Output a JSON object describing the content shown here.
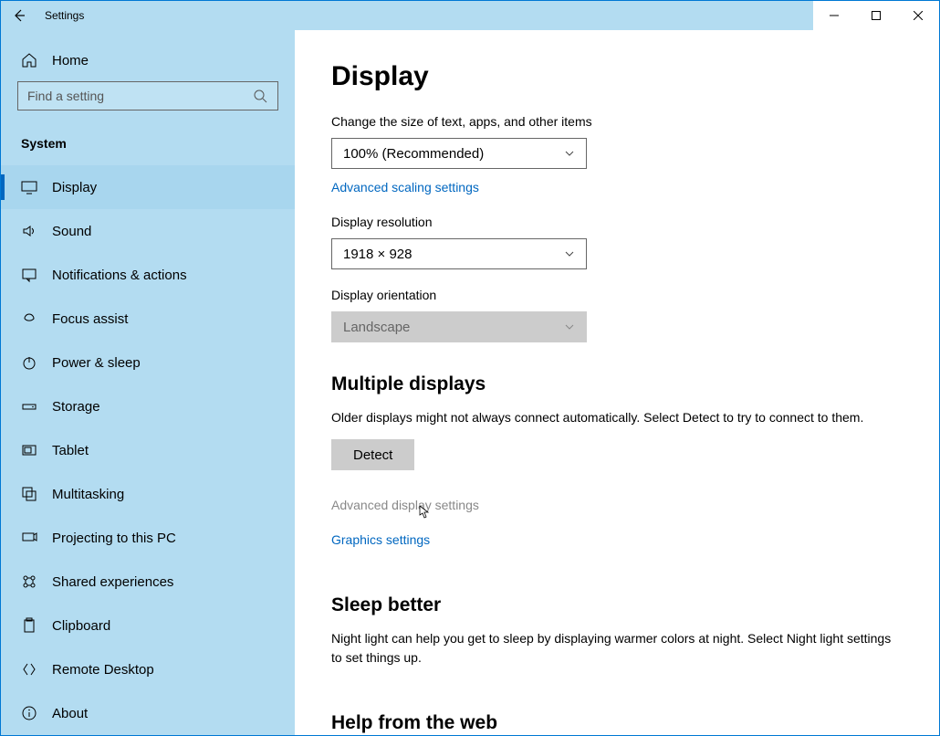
{
  "titlebar": {
    "title": "Settings"
  },
  "sidebar": {
    "home": "Home",
    "search_placeholder": "Find a setting",
    "category": "System",
    "items": [
      {
        "label": "Display",
        "icon": "display",
        "active": true
      },
      {
        "label": "Sound",
        "icon": "sound"
      },
      {
        "label": "Notifications & actions",
        "icon": "notifications"
      },
      {
        "label": "Focus assist",
        "icon": "focus"
      },
      {
        "label": "Power & sleep",
        "icon": "power"
      },
      {
        "label": "Storage",
        "icon": "storage"
      },
      {
        "label": "Tablet",
        "icon": "tablet"
      },
      {
        "label": "Multitasking",
        "icon": "multitasking"
      },
      {
        "label": "Projecting to this PC",
        "icon": "project"
      },
      {
        "label": "Shared experiences",
        "icon": "shared"
      },
      {
        "label": "Clipboard",
        "icon": "clipboard"
      },
      {
        "label": "Remote Desktop",
        "icon": "remote"
      },
      {
        "label": "About",
        "icon": "about"
      }
    ]
  },
  "page": {
    "title": "Display",
    "scale_label": "Change the size of text, apps, and other items",
    "scale_value": "100% (Recommended)",
    "advanced_scaling": "Advanced scaling settings",
    "resolution_label": "Display resolution",
    "resolution_value": "1918 × 928",
    "orientation_label": "Display orientation",
    "orientation_value": "Landscape",
    "multiple_h": "Multiple displays",
    "multiple_desc": "Older displays might not always connect automatically. Select Detect to try to connect to them.",
    "detect": "Detect",
    "adv_display": "Advanced display settings",
    "graphics": "Graphics settings",
    "sleep_h": "Sleep better",
    "sleep_desc": "Night light can help you get to sleep by displaying warmer colors at night. Select Night light settings to set things up.",
    "help_h": "Help from the web"
  }
}
